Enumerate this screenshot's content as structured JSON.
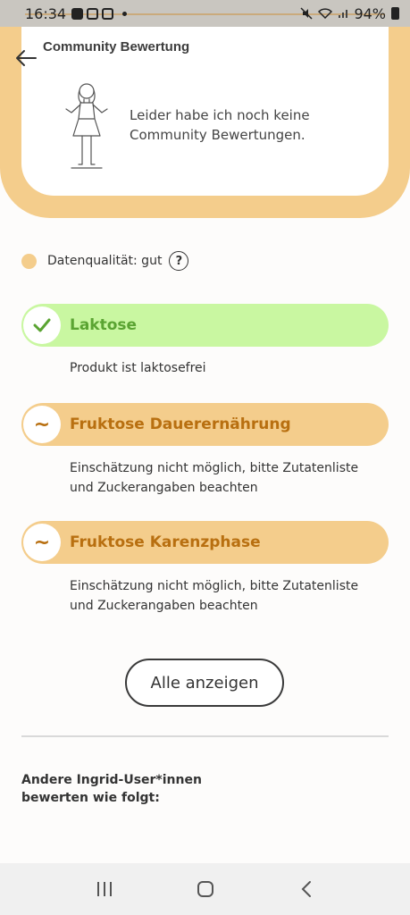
{
  "status_bar": {
    "time": "16:34",
    "battery": "94%"
  },
  "community": {
    "title": "Community Bewertung",
    "empty_text": "Leider habe ich noch keine Community Bewertungen."
  },
  "quality": {
    "label": "Datenqualität: gut",
    "help": "?"
  },
  "ratings": [
    {
      "badge": "✓",
      "label": "Laktose",
      "description": "Produkt ist laktosefrei",
      "status_color": "#c9f7a1"
    },
    {
      "badge": "~",
      "label": "Fruktose Dauerernährung",
      "description": "Einschätzung nicht möglich, bitte Zutatenliste und Zuckerangaben beachten",
      "status_color": "#f4cd8c"
    },
    {
      "badge": "~",
      "label": "Fruktose Karenzphase",
      "description": "Einschätzung nicht möglich, bitte Zutatenliste und Zuckerangaben beachten",
      "status_color": "#f4cd8c"
    }
  ],
  "show_all_label": "Alle anzeigen",
  "others_text": "Andere Ingrid-User*innen bewerten wie folgt:",
  "colors": {
    "accent": "#f4cd8c",
    "good": "#c9f7a1"
  }
}
